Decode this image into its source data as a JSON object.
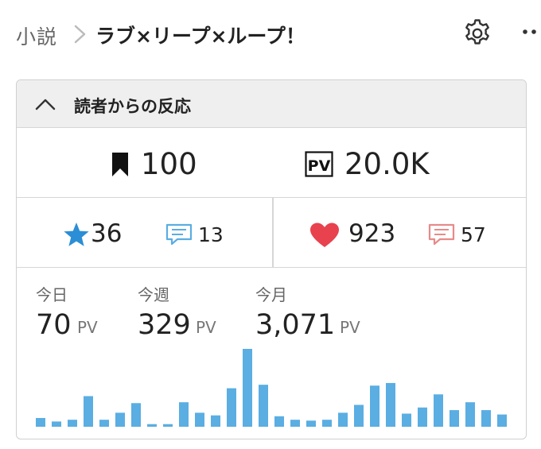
{
  "breadcrumb": {
    "category": "小説",
    "work_title": "ラブ×リープ×ループ！"
  },
  "icons": {
    "settings": "gear-icon",
    "more": "more-icon",
    "collapse": "chevron-up-icon",
    "bookmark": "bookmark-icon",
    "pv": "pv-icon",
    "star": "star-icon",
    "comment": "comment-icon",
    "heart": "heart-icon"
  },
  "colors": {
    "accent_blue": "#2b8ed6",
    "heart_red": "#e8424e",
    "bar_blue": "#5aaee2",
    "comment_red": "#e88a8a"
  },
  "panel": {
    "title": "読者からの反応",
    "bookmarks": "100",
    "pv_total": "20.0K",
    "stars": "36",
    "star_comments": "13",
    "hearts": "923",
    "heart_comments": "57"
  },
  "pv_stats": {
    "today_label": "今日",
    "today_value": "70",
    "today_unit": "PV",
    "week_label": "今週",
    "week_value": "329",
    "week_unit": "PV",
    "month_label": "今月",
    "month_value": "3,071",
    "month_unit": "PV"
  },
  "chart_data": {
    "type": "bar",
    "title": "",
    "values": [
      10,
      6,
      8,
      35,
      8,
      16,
      27,
      3,
      3,
      28,
      16,
      13,
      44,
      89,
      48,
      12,
      8,
      7,
      8,
      16,
      25,
      47,
      50,
      15,
      22,
      37,
      19,
      28,
      19,
      14
    ]
  }
}
